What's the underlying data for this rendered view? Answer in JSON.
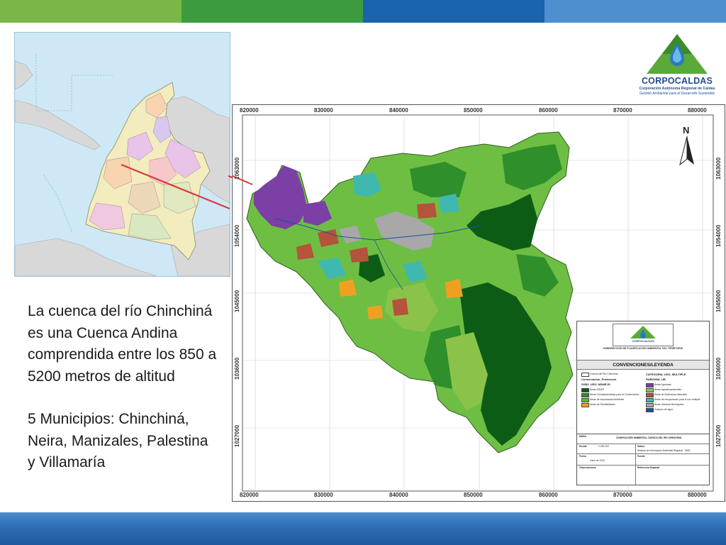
{
  "slide": {
    "top_bar_colors": [
      "#7ab648",
      "#3c9b3f",
      "#1a63ae",
      "#4e8fd0"
    ],
    "description": {
      "paragraph1": "La cuenca del río Chinchiná es una Cuenca Andina comprendida entre los 850 a 5200 metros de altitud",
      "paragraph2": "5 Municipios: Chinchiná, Neira, Manizales, Palestina y Villamaría"
    }
  },
  "logo": {
    "name": "CORPOCALDAS",
    "subtitle1": "Corporación Autónoma Regional de Caldas",
    "subtitle2": "Gestión Ambiental para el Desarrollo Sostenible"
  },
  "map": {
    "x_ticks": [
      "820000",
      "830000",
      "840000",
      "850000",
      "860000",
      "870000",
      "880000"
    ],
    "y_ticks": [
      "1063000",
      "1054000",
      "1045000",
      "1036000",
      "1027000"
    ],
    "north_label": "N",
    "legend": {
      "logo_text": "CORPOCALDAS",
      "subheading": "SUBDIRECCIÓN DE PLANIFICACIÓN AMBIENTAL DEL TERRITORIO",
      "title": "CONVENCIONES/LEYENDA",
      "boundary_label": "Cuenca del Río Chinchiná",
      "left_heading1": "Conservacion_Proteccion",
      "left_heading2": "SUB2_USO_MANEJO",
      "left_items": [
        {
          "label": "Áreas SINAP",
          "color": "#0d5c16"
        },
        {
          "label": "Áreas Complementarias para la Conservación",
          "color": "#2f8f2a"
        },
        {
          "label": "Áreas de Importancia Ambiental",
          "color": "#5fb833"
        },
        {
          "label": "Áreas de Rehabilitación",
          "color": "#f0a020"
        }
      ],
      "right_heading1": "CATEGORIA_USO_MULTIPLE",
      "right_heading2": "SUBZONA_UR",
      "right_items": [
        {
          "label": "Áreas Agrícolas",
          "color": "#7b3fa6"
        },
        {
          "label": "Áreas Agrosilvopastoriles",
          "color": "#8bc34a"
        },
        {
          "label": "Áreas de Amenazas Naturales",
          "color": "#b5533b"
        },
        {
          "label": "Áreas de recuperación para el uso múltiple",
          "color": "#3fb8b0"
        },
        {
          "label": "Áreas Urbanas Municipales",
          "color": "#a8a8a8"
        },
        {
          "label": "Cuerpos de agua",
          "color": "#1c4fa0"
        }
      ],
      "titleblock": {
        "mapa_label": "MAPA:",
        "mapa_value": "ZONIFICACIÓN AMBIENTAL CUENCA DEL RÍO CHINCHINÁ",
        "escala_label": "Escala",
        "escala_value": "1:250.000",
        "datum_label": "Datum",
        "datum_value": "Sistema de Información Ambiental Regional - SIAR",
        "fecha_label": "Fecha",
        "fecha_value": "Junio de 2016",
        "fuente_label": "Fuente",
        "observaciones_label": "Observaciones",
        "referencia_label": "Referencia Espacial"
      }
    }
  }
}
